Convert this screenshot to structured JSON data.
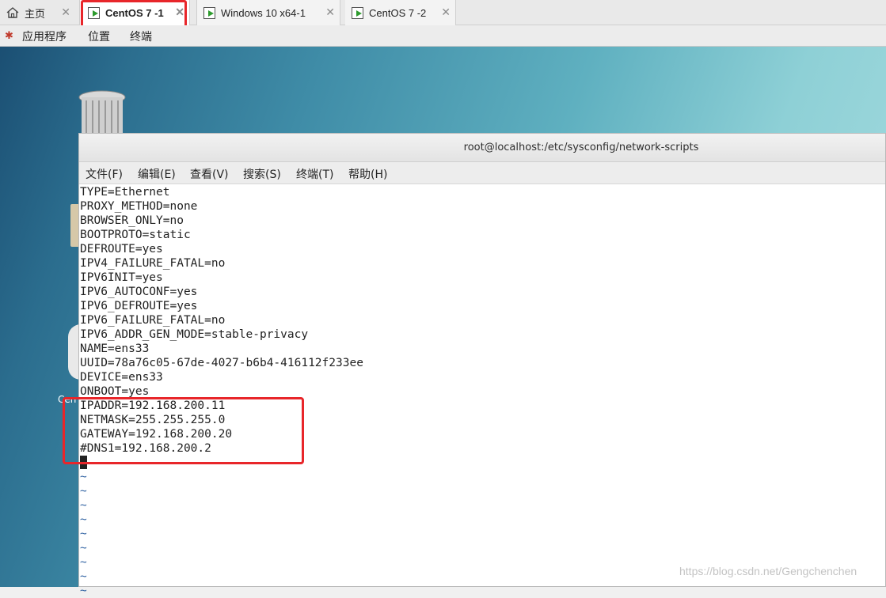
{
  "tabs": [
    {
      "label": "主页",
      "icon": "home-icon"
    },
    {
      "label": "CentOS 7 -1",
      "icon": "vm-icon",
      "active": true
    },
    {
      "label": "Windows 10 x64-1",
      "icon": "vm-icon"
    },
    {
      "label": "CentOS 7 -2",
      "icon": "vm-icon"
    }
  ],
  "close_glyph": "✕",
  "gnome": {
    "apps": "应用程序",
    "places": "位置",
    "terminal": "终端"
  },
  "desktop": {
    "label_fragment": "Cen"
  },
  "terminal": {
    "title": "root@localhost:/etc/sysconfig/network-scripts",
    "menu": [
      "文件(F)",
      "编辑(E)",
      "查看(V)",
      "搜索(S)",
      "终端(T)",
      "帮助(H)"
    ],
    "lines": [
      "TYPE=Ethernet",
      "PROXY_METHOD=none",
      "BROWSER_ONLY=no",
      "BOOTPROTO=static",
      "DEFROUTE=yes",
      "IPV4_FAILURE_FATAL=no",
      "IPV6INIT=yes",
      "IPV6_AUTOCONF=yes",
      "IPV6_DEFROUTE=yes",
      "IPV6_FAILURE_FATAL=no",
      "IPV6_ADDR_GEN_MODE=stable-privacy",
      "NAME=ens33",
      "UUID=78a76c05-67de-4027-b6b4-416112f233ee",
      "DEVICE=ens33",
      "ONBOOT=yes",
      "IPADDR=192.168.200.11",
      "NETMASK=255.255.255.0",
      "GATEWAY=192.168.200.20",
      "#DNS1=192.168.200.2"
    ],
    "tilde": "~"
  },
  "watermark": "https://blog.csdn.net/Gengchenchen",
  "colors": {
    "highlight": "#e8262a",
    "tilde": "#3465a4",
    "vm_play": "#2e9b2e"
  }
}
